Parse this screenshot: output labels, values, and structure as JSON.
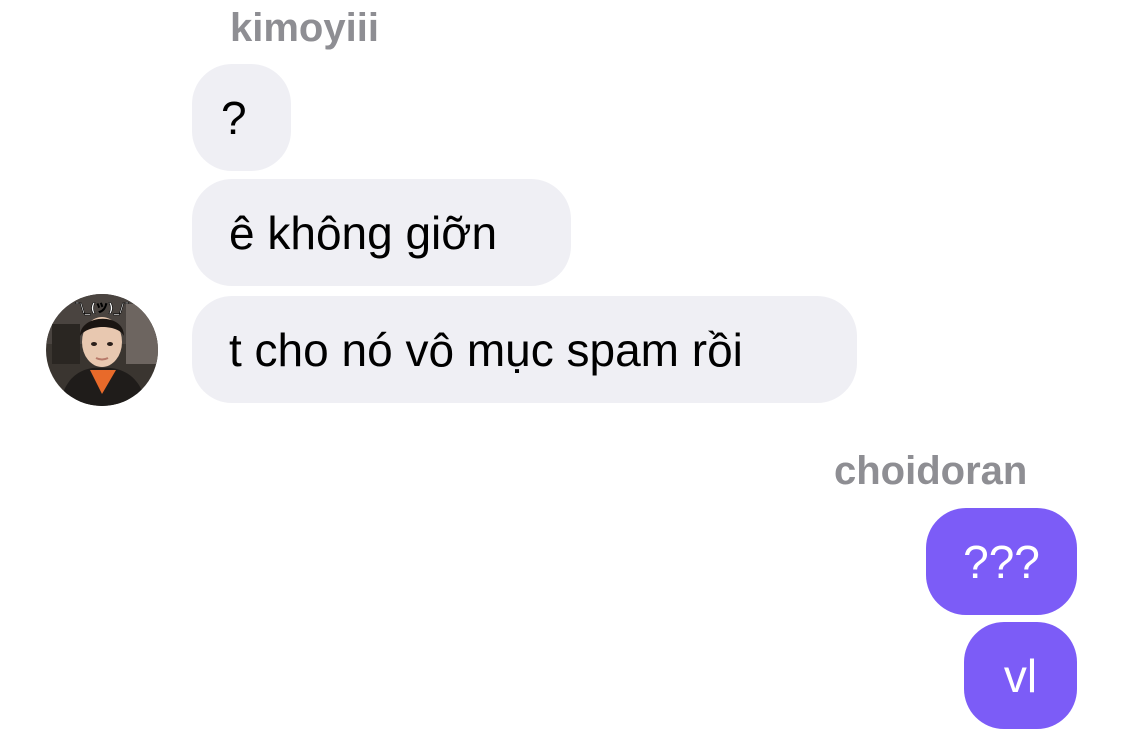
{
  "conversation": {
    "incoming": {
      "sender": "kimoyiii",
      "messages": [
        "?",
        "ê không giỡn",
        "t cho nó vô mục spam rồi"
      ],
      "avatar_icon": "profile-photo",
      "avatar_caption": "¯\\_(ツ)_/¯"
    },
    "outgoing": {
      "sender": "choidoran",
      "messages": [
        "???",
        "vl"
      ]
    }
  },
  "colors": {
    "incoming_bubble": "#efeff4",
    "outgoing_bubble": "#7c5cf7",
    "sender_name": "#8e8e93",
    "message_text": "#000000",
    "outgoing_text": "#ffffff"
  }
}
